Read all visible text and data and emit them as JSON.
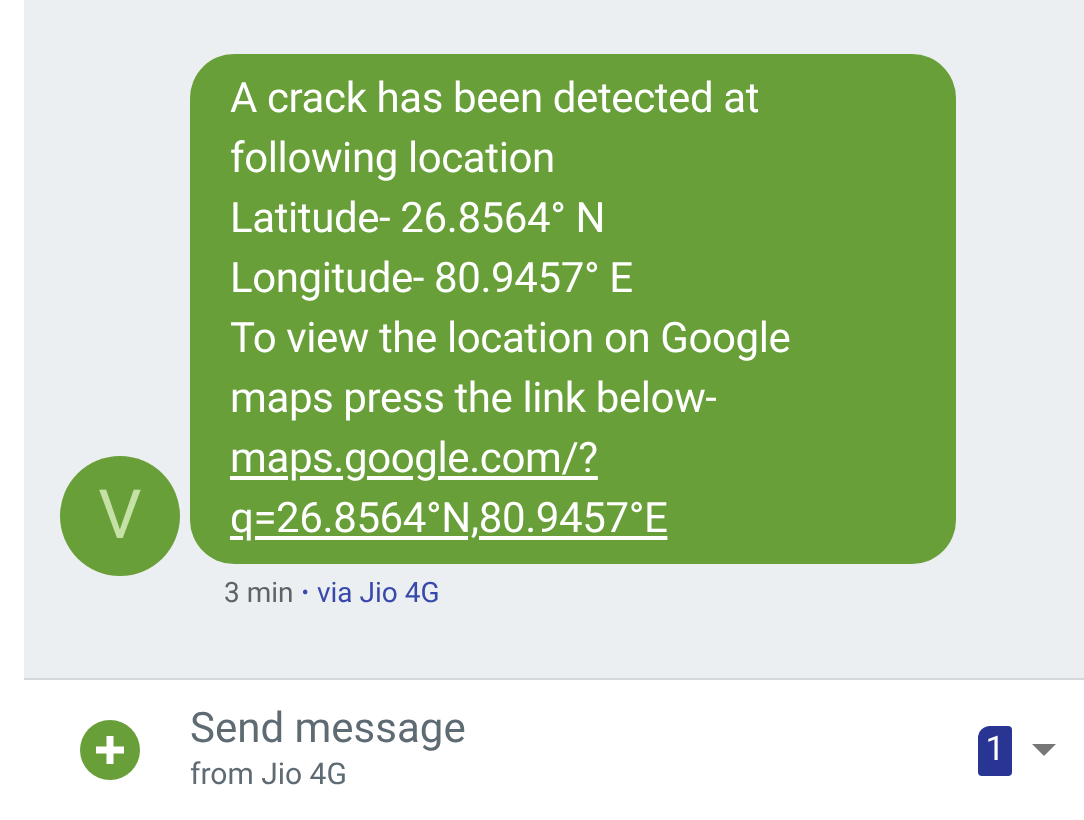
{
  "message": {
    "sender_initial": "V",
    "lines": [
      "A crack has been detected at",
      "following location",
      "Latitude- 26.8564° N",
      "Longitude- 80.9457° E",
      "To view the location on Google",
      "maps press the link below-"
    ],
    "link_lines": [
      "maps.google.com/?",
      "q=26.8564°N,80.9457°E"
    ],
    "time": "3 min",
    "separator": "•",
    "network": "via Jio 4G"
  },
  "compose": {
    "placeholder": "Send message",
    "subtitle": "from Jio 4G",
    "sim": "1"
  }
}
